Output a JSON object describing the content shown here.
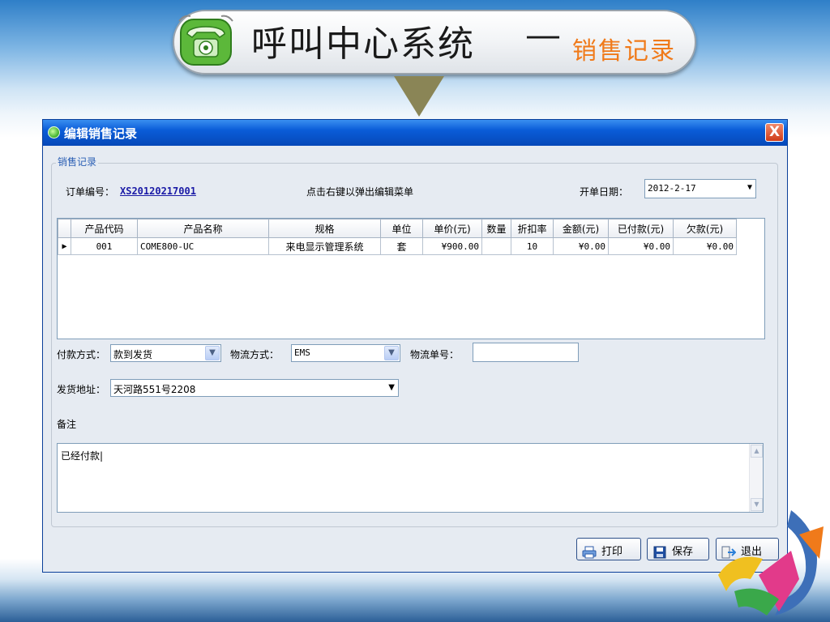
{
  "slide": {
    "title": "呼叫中心系统",
    "dash": "—",
    "subtitle": "销售记录"
  },
  "window": {
    "title": "编辑销售记录",
    "close_glyph": "X",
    "group_title": "销售记录",
    "order_label": "订单编号：",
    "order_no": "XS20120217001",
    "hint": "点击右键以弹出编辑菜单",
    "date_label": "开单日期：",
    "date_value": "2012-2-17"
  },
  "grid": {
    "columns": [
      "产品代码",
      "产品名称",
      "规格",
      "单位",
      "单价(元)",
      "数量",
      "折扣率",
      "金额(元)",
      "已付款(元)",
      "欠款(元)"
    ],
    "rows": [
      {
        "indicator": "▶",
        "code": "001",
        "name": "COME800-UC",
        "spec": "来电显示管理系统",
        "unit": "套",
        "price": "¥900.00",
        "qty": "",
        "discount": "10",
        "amount": "¥0.00",
        "paid": "¥0.00",
        "owed": "¥0.00"
      }
    ]
  },
  "form": {
    "payment_label": "付款方式：",
    "payment_value": "款到发货",
    "logistics_label": "物流方式：",
    "logistics_value": "EMS",
    "tracking_label": "物流单号：",
    "tracking_value": "",
    "address_label": "发货地址：",
    "address_value": "天河路551号2208",
    "remark_label": "备注",
    "remark_value": "已经付款|"
  },
  "buttons": {
    "print": "打印",
    "save": "保存",
    "exit": "退出"
  },
  "colors": {
    "title_bar": "#0a5cd8",
    "subtitle": "#f07a1a",
    "order_no": "#1a1aa6",
    "close": "#d03b17"
  }
}
